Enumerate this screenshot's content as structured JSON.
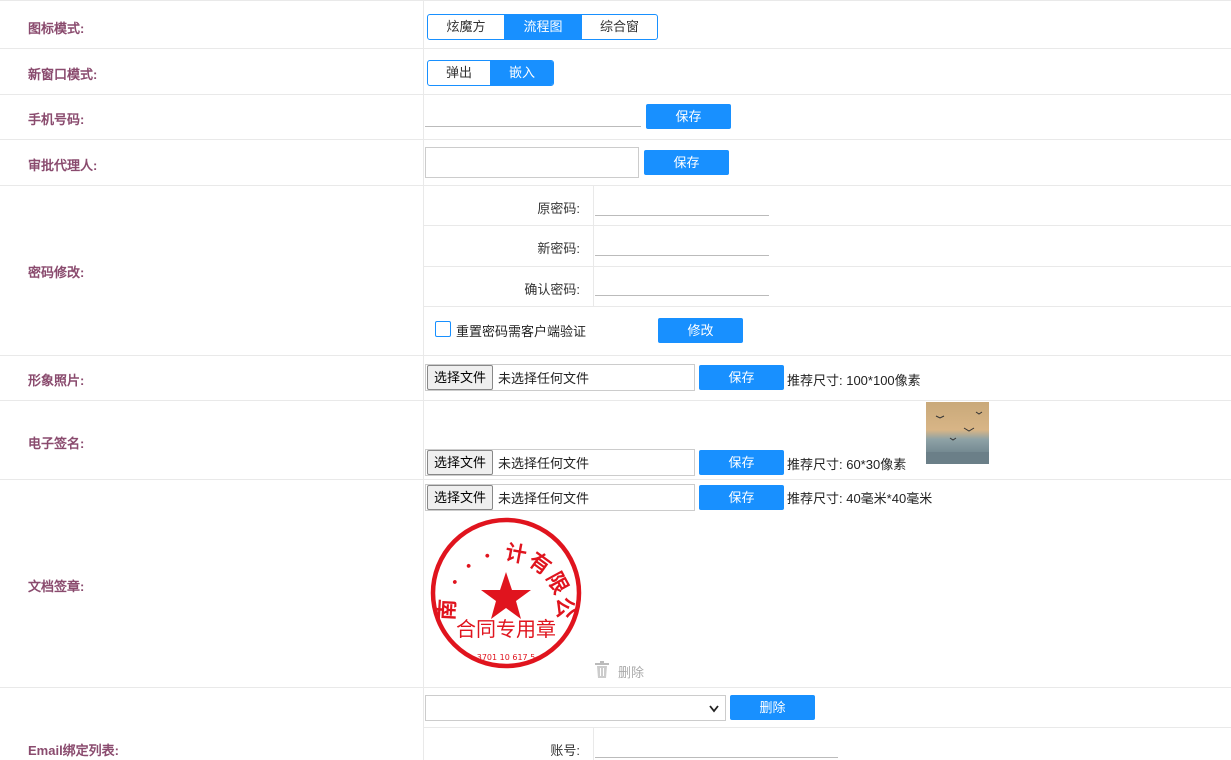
{
  "icon_mode": {
    "label": "图标模式:",
    "options": [
      "炫魔方",
      "流程图",
      "综合窗"
    ],
    "selected": "流程图"
  },
  "window_mode": {
    "label": "新窗口模式:",
    "options": [
      "弹出",
      "嵌入"
    ],
    "selected": "嵌入"
  },
  "phone": {
    "label": "手机号码:",
    "value": "",
    "save": "保存"
  },
  "delegate": {
    "label": "审批代理人:",
    "value": "",
    "save": "保存"
  },
  "password": {
    "label": "密码修改:",
    "old_label": "原密码:",
    "new_label": "新密码:",
    "confirm_label": "确认密码:",
    "checkbox_label": "重置密码需客户端验证",
    "checkbox_checked": false,
    "submit": "修改"
  },
  "photo": {
    "label": "形象照片:",
    "choose": "选择文件",
    "no_file": "未选择任何文件",
    "save": "保存",
    "hint": "推荐尺寸: 100*100像素"
  },
  "signature": {
    "label": "电子签名:",
    "choose": "选择文件",
    "no_file": "未选择任何文件",
    "save": "保存",
    "hint": "推荐尺寸: 60*30像素"
  },
  "stamp": {
    "label": "文档签章:",
    "choose": "选择文件",
    "no_file": "未选择任何文件",
    "save": "保存",
    "hint": "推荐尺寸: 40毫米*40毫米",
    "seal_ring_text": "济南 · · · 计有限公司",
    "seal_center_text": "合同专用章",
    "seal_number": "3701 10 617 5",
    "delete": "删除"
  },
  "email": {
    "label": "Email绑定列表:",
    "select_value": "",
    "delete": "删除",
    "account_label": "账号:"
  },
  "colors": {
    "accent": "#1890ff",
    "label": "#8a4b6e",
    "seal": "#e0141e"
  }
}
